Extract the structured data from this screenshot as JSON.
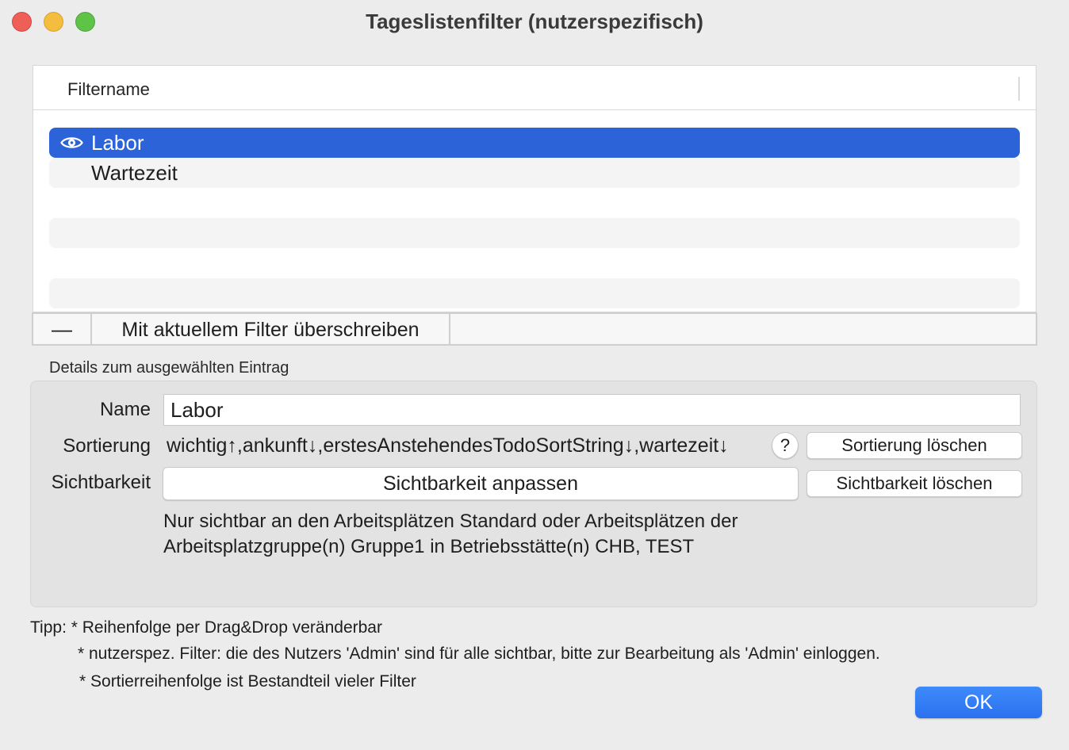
{
  "window": {
    "title": "Tageslistenfilter (nutzerspezifisch)",
    "colors": {
      "close": "#ee5f57",
      "minimize": "#f5bd3d",
      "maximize": "#5fc348"
    }
  },
  "filter_table": {
    "column_header": "Filtername",
    "rows": [
      {
        "label": "Labor",
        "selected": true,
        "icon": "eye-icon"
      },
      {
        "label": "Wartezeit",
        "selected": false,
        "icon": ""
      }
    ],
    "selection_color": "#2c63d9"
  },
  "table_tools": {
    "remove_label": "—",
    "overwrite_label": "Mit aktuellem Filter überschreiben"
  },
  "details": {
    "caption": "Details zum ausgewählten Eintrag",
    "name_label": "Name",
    "name_value": "Labor",
    "sort_label": "Sortierung",
    "sort_value": "wichtig↑,ankunft↓,erstesAnstehendesTodoSortString↓,wartezeit↓",
    "help_label": "?",
    "clear_sort_label": "Sortierung löschen",
    "visibility_label": "Sichtbarkeit",
    "adjust_visibility_label": "Sichtbarkeit anpassen",
    "clear_visibility_label": "Sichtbarkeit löschen",
    "visibility_text_line1": "Nur sichtbar an den Arbeitsplätzen Standard oder Arbeitsplätzen der",
    "visibility_text_line2": "Arbeitsplatzgruppe(n) Gruppe1 in Betriebsstätte(n) CHB, TEST"
  },
  "tips": {
    "line1": "Tipp: * Reihenfolge per Drag&Drop veränderbar",
    "line2": "* nutzerspez. Filter: die des Nutzers 'Admin' sind für alle sichtbar, bitte zur Bearbeitung als 'Admin' einloggen.",
    "line3": "* Sortierreihenfolge ist Bestandteil vieler Filter"
  },
  "ok_button": {
    "label": "OK",
    "color": "#2b71ef"
  }
}
